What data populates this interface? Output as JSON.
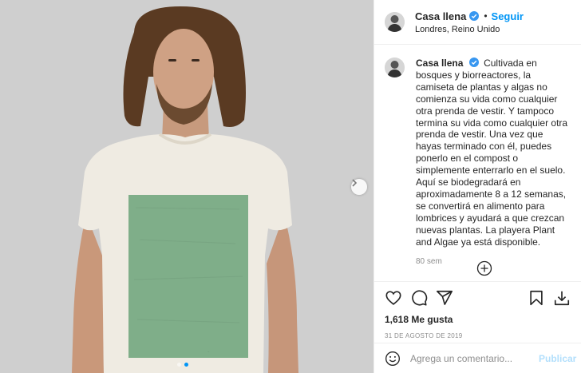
{
  "post": {
    "username": "Casa llena",
    "follow_label": "Seguir",
    "separator": "•",
    "location": "Londres, Reino Unido",
    "caption": "Cultivada en bosques y biorreactores, la camiseta de plantas y algas no comienza su vida como cualquier otra prenda de vestir. Y tampoco termina su vida como cualquier otra prenda de vestir. Una vez que hayas terminado con él, puedes ponerlo en el compost o simplemente enterrarlo en el suelo. Aquí se biodegradará en aproximadamente 8 a 12 semanas, se convertirá en alimento para lombrices y ayudará a que crezcan nuevas plantas. La playera Plant and Algae ya está disponible.",
    "caption_age": "80 sem",
    "likes": "1,618 Me gusta",
    "date": "31 DE AGOSTO DE 2019"
  },
  "carousel": {
    "total": 2,
    "current": 2
  },
  "comment": {
    "placeholder": "Agrega un comentario...",
    "publish_label": "Publicar"
  },
  "colors": {
    "accent": "#0095f6",
    "shirt_print": "#7fae89",
    "publish_disabled": "#b2dffc"
  },
  "icons": [
    "verified-badge-icon",
    "chevron-right-icon",
    "add-circle-icon",
    "heart-icon",
    "comment-icon",
    "share-icon",
    "bookmark-icon",
    "download-icon",
    "emoji-icon"
  ]
}
